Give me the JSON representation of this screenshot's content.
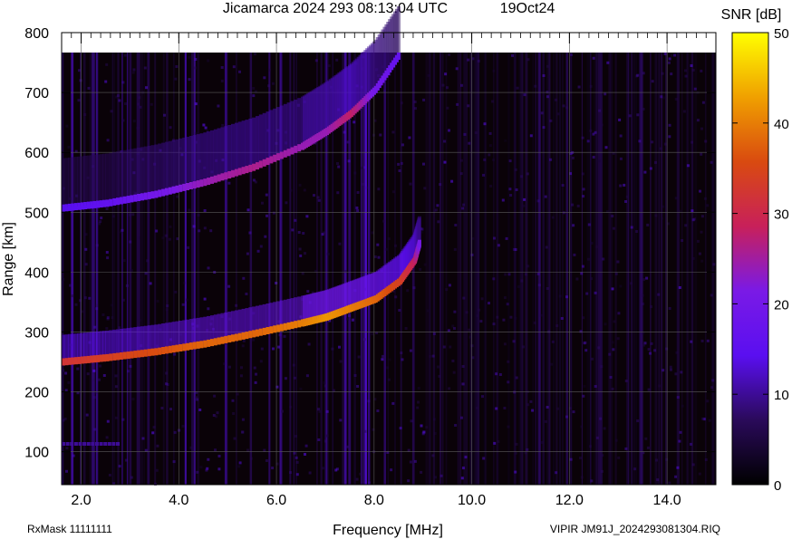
{
  "header": {
    "title": "Jicamarca 2024 293 08:13:04 UTC",
    "date": "19Oct24"
  },
  "footer": {
    "left": "RxMask 11111111",
    "right": "VIPIR  JM91J_2024293081304.RIQ"
  },
  "colorbar": {
    "label": "SNR [dB]",
    "ticks": [
      0,
      10,
      20,
      30,
      40,
      50
    ],
    "range": [
      0,
      50
    ],
    "colors": [
      "#000000",
      "#2a0a5a",
      "#5a0ff0",
      "#7a1ae6",
      "#c8205a",
      "#d94a10",
      "#f0a000",
      "#ffff00"
    ]
  },
  "chart_data": {
    "type": "heatmap",
    "title": "Jicamarca 2024 293 08:13:04 UTC",
    "xlabel": "Frequency [MHz]",
    "ylabel": "Range [km]",
    "xlim": [
      1.6,
      15.0
    ],
    "ylim": [
      45,
      800
    ],
    "x_ticks": [
      "2.0",
      "4.0",
      "6.0",
      "8.0",
      "10.0",
      "12.0",
      "14.0"
    ],
    "y_ticks": [
      "100",
      "200",
      "300",
      "400",
      "500",
      "600",
      "700",
      "800"
    ],
    "grid": true,
    "color_scale": "SNR [dB]",
    "traces": [
      {
        "name": "",
        "points": [
          [
            1.6,
            250
          ],
          [
            2.5,
            257
          ],
          [
            3.5,
            267
          ],
          [
            4.5,
            280
          ],
          [
            5.5,
            297
          ],
          [
            6.5,
            315
          ],
          [
            7.0,
            325
          ],
          [
            7.5,
            340
          ],
          [
            8.0,
            355
          ],
          [
            8.5,
            385
          ],
          [
            8.8,
            420
          ],
          [
            8.9,
            450
          ]
        ],
        "snr_db": [
          32,
          34,
          36,
          38,
          38,
          40,
          42,
          40,
          38,
          34,
          28,
          20
        ]
      },
      {
        "name": "",
        "points": [
          [
            1.6,
            507
          ],
          [
            2.5,
            515
          ],
          [
            3.5,
            530
          ],
          [
            4.5,
            550
          ],
          [
            5.5,
            575
          ],
          [
            6.5,
            610
          ],
          [
            7.0,
            635
          ],
          [
            7.5,
            665
          ],
          [
            8.0,
            705
          ],
          [
            8.5,
            765
          ]
        ],
        "snr_db": [
          14,
          16,
          20,
          24,
          26,
          24,
          24,
          28,
          20,
          16
        ]
      },
      {
        "name": "",
        "points": [
          [
            1.6,
            110
          ],
          [
            2.8,
            110
          ]
        ],
        "snr_db": [
          10,
          10
        ]
      }
    ]
  }
}
